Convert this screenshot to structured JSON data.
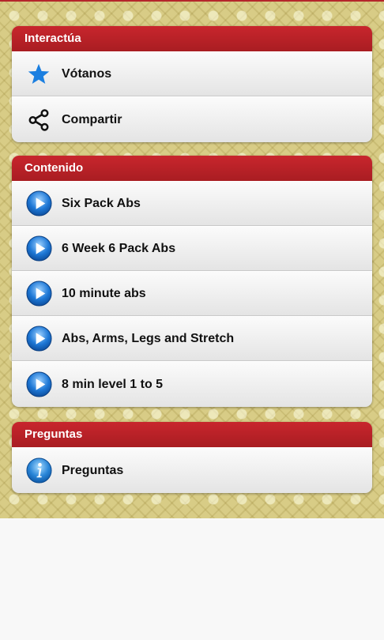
{
  "sections": [
    {
      "title": "Interactúa",
      "items": [
        {
          "label": "Vótanos",
          "icon": "star-icon"
        },
        {
          "label": "Compartir",
          "icon": "share-icon"
        }
      ]
    },
    {
      "title": "Contenido",
      "items": [
        {
          "label": "Six Pack Abs",
          "icon": "play-icon"
        },
        {
          "label": "6 Week 6 Pack Abs",
          "icon": "play-icon"
        },
        {
          "label": "10 minute abs",
          "icon": "play-icon"
        },
        {
          "label": "Abs, Arms, Legs and Stretch",
          "icon": "play-icon"
        },
        {
          "label": "8 min level 1 to 5",
          "icon": "play-icon"
        }
      ]
    },
    {
      "title": "Preguntas",
      "items": [
        {
          "label": "Preguntas",
          "icon": "info-icon"
        }
      ]
    }
  ],
  "colors": {
    "header_red": "#b7232a",
    "accent_blue": "#1b7fe0",
    "background_gold": "#d8cc86"
  }
}
